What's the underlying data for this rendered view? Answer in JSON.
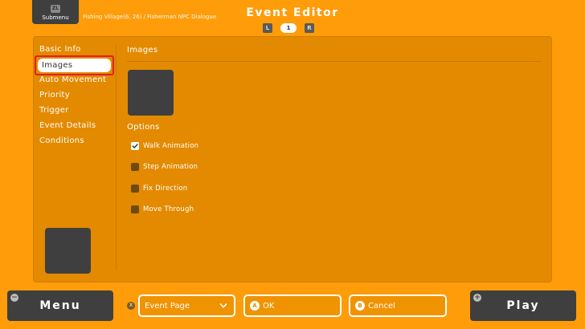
{
  "header": {
    "submenu_key": "ZL",
    "submenu_label": "Submenu",
    "breadcrumb": "Fishing Village(6, 26) / Fisherman NPC Dialogue",
    "title": "Event Editor",
    "pager": {
      "prev_key": "L",
      "page": "1",
      "next_key": "R"
    }
  },
  "sidebar": {
    "items": [
      {
        "label": "Basic Info"
      },
      {
        "label": "Images"
      },
      {
        "label": "Auto Movement"
      },
      {
        "label": "Priority"
      },
      {
        "label": "Trigger"
      },
      {
        "label": "Event Details"
      },
      {
        "label": "Conditions"
      }
    ],
    "active": "Images"
  },
  "content": {
    "section_title": "Images",
    "options_title": "Options",
    "options": [
      {
        "label": "Walk Animation",
        "checked": true
      },
      {
        "label": "Step Animation",
        "checked": false
      },
      {
        "label": "Fix Direction",
        "checked": false
      },
      {
        "label": "Move Through",
        "checked": false
      }
    ]
  },
  "footer": {
    "menu_key": "−",
    "menu_label": "Menu",
    "x_key": "X",
    "event_page_label": "Event Page",
    "ok_key": "A",
    "ok_label": "OK",
    "cancel_key": "B",
    "cancel_label": "Cancel",
    "play_key": "+",
    "play_label": "Play"
  },
  "colors": {
    "background": "#ff9c0a",
    "panel": "#e38a00",
    "dark": "#3f3f3f",
    "selection_outline": "#e02020"
  }
}
